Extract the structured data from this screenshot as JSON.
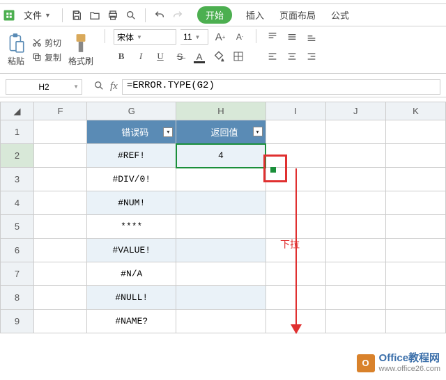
{
  "menubar": {
    "file": "文件",
    "tabs": [
      "开始",
      "插入",
      "页面布局",
      "公式"
    ]
  },
  "ribbon": {
    "paste": "粘贴",
    "cut": "剪切",
    "copy": "复制",
    "format_painter": "格式刷",
    "font_name": "宋体",
    "font_size": "11",
    "bold": "B",
    "italic": "I",
    "underline": "U",
    "strike": "A",
    "increase_font": "A",
    "decrease_font": "A"
  },
  "formula_bar": {
    "name_box": "H2",
    "formula": "=ERROR.TYPE(G2)"
  },
  "col_headers": [
    "F",
    "G",
    "H",
    "I",
    "J",
    "K"
  ],
  "row_headers": [
    "1",
    "2",
    "3",
    "4",
    "5",
    "6",
    "7",
    "8",
    "9"
  ],
  "table": {
    "header_g": "错误码",
    "header_h": "返回值",
    "rows": [
      {
        "g": "#REF!",
        "h": "4"
      },
      {
        "g": "#DIV/0!",
        "h": ""
      },
      {
        "g": "#NUM!",
        "h": ""
      },
      {
        "g": "****",
        "h": ""
      },
      {
        "g": "#VALUE!",
        "h": ""
      },
      {
        "g": "#N/A",
        "h": ""
      },
      {
        "g": "#NULL!",
        "h": ""
      },
      {
        "g": "#NAME?",
        "h": ""
      }
    ]
  },
  "annotation": "下拉",
  "watermark": {
    "icon_letter": "O",
    "title": "Office教程网",
    "url": "www.office26.com"
  }
}
